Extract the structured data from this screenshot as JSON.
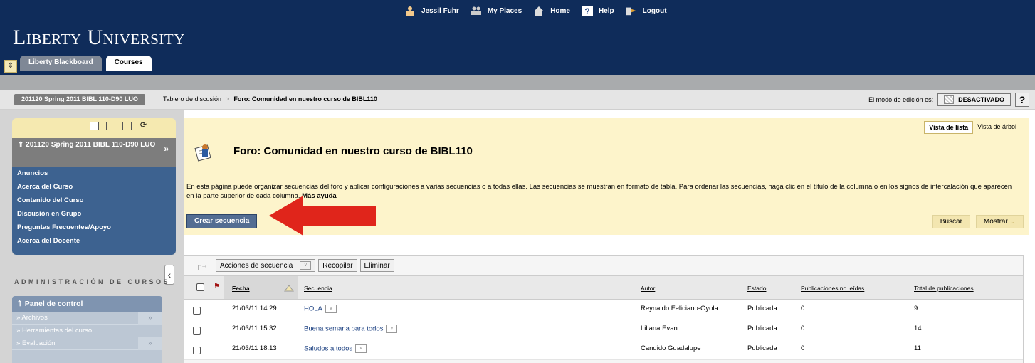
{
  "header": {
    "links": [
      {
        "label": "Jessil Fuhr",
        "icon": "user-icon"
      },
      {
        "label": "My Places",
        "icon": "people-icon"
      },
      {
        "label": "Home",
        "icon": "home-icon"
      },
      {
        "label": "Help",
        "icon": "help-icon"
      },
      {
        "label": "Logout",
        "icon": "logout-icon"
      }
    ],
    "logo": "Liberty University",
    "tabs": [
      "Liberty Blackboard",
      "Courses"
    ]
  },
  "breadcrumb": {
    "course": "201120 Spring 2011 BIBL 110-D90 LUO",
    "items": [
      "Tablero de discusión",
      "Foro: Comunidad en nuestro curso de BIBL110"
    ],
    "sep": ">",
    "edit_mode_label": "El modo de edición es:",
    "edit_mode_value": "DESACTIVADO",
    "help": "?"
  },
  "sidebar": {
    "course_title": "201120 Spring 2011 BIBL 110-D90 LUO",
    "course_arrow": "»",
    "items": [
      "Anuncios",
      "Acerca del Curso",
      "Contenido del Curso",
      "Discusión en Grupo",
      "Preguntas Frecuentes/Apoyo",
      "Acerca del Docente"
    ],
    "admin_title": "ADMINISTRACIÓN DE CURSOS",
    "panel_title": "Panel de control",
    "panel_items": [
      "Archivos",
      "Herramientas del curso",
      "Evaluación"
    ]
  },
  "forum": {
    "view_list": "Vista de lista",
    "view_tree": "Vista de árbol",
    "title": "Foro: Comunidad en nuestro curso de BIBL110",
    "description": "En esta página puede organizar secuencias del foro y aplicar configuraciones a varias secuencias o a todas ellas. Las secuencias se muestran en formato de tabla. Para ordenar las secuencias, haga clic en el título de la columna o en los signos de intercalación que aparecen en la parte superior de cada columna.",
    "more_help": "Más ayuda",
    "create_button": "Crear secuencia",
    "search_button": "Buscar",
    "show_button": "Mostrar"
  },
  "table": {
    "actions": [
      "Acciones de secuencia",
      "Recopilar",
      "Eliminar"
    ],
    "columns": [
      "Fecha",
      "Secuencia",
      "Autor",
      "Estado",
      "Publicaciones no leídas",
      "Total de publicaciones"
    ],
    "rows": [
      {
        "fecha": "21/03/11 14:29",
        "secuencia": "HOLA",
        "autor": "Reynaldo Feliciano-Oyola",
        "estado": "Publicada",
        "no_leidas": "0",
        "total": "9"
      },
      {
        "fecha": "21/03/11 15:32",
        "secuencia": "Buena semana para todos",
        "autor": "Liliana Evan",
        "estado": "Publicada",
        "no_leidas": "0",
        "total": "14"
      },
      {
        "fecha": "21/03/11 18:13",
        "secuencia": "Saludos a todos",
        "autor": "Candido Guadalupe",
        "estado": "Publicada",
        "no_leidas": "0",
        "total": "11"
      }
    ]
  },
  "colors": {
    "header": "#0f2c5a",
    "menu": "#3d6290",
    "highlight": "#fdf4cb",
    "arrow": "#e0251b"
  }
}
